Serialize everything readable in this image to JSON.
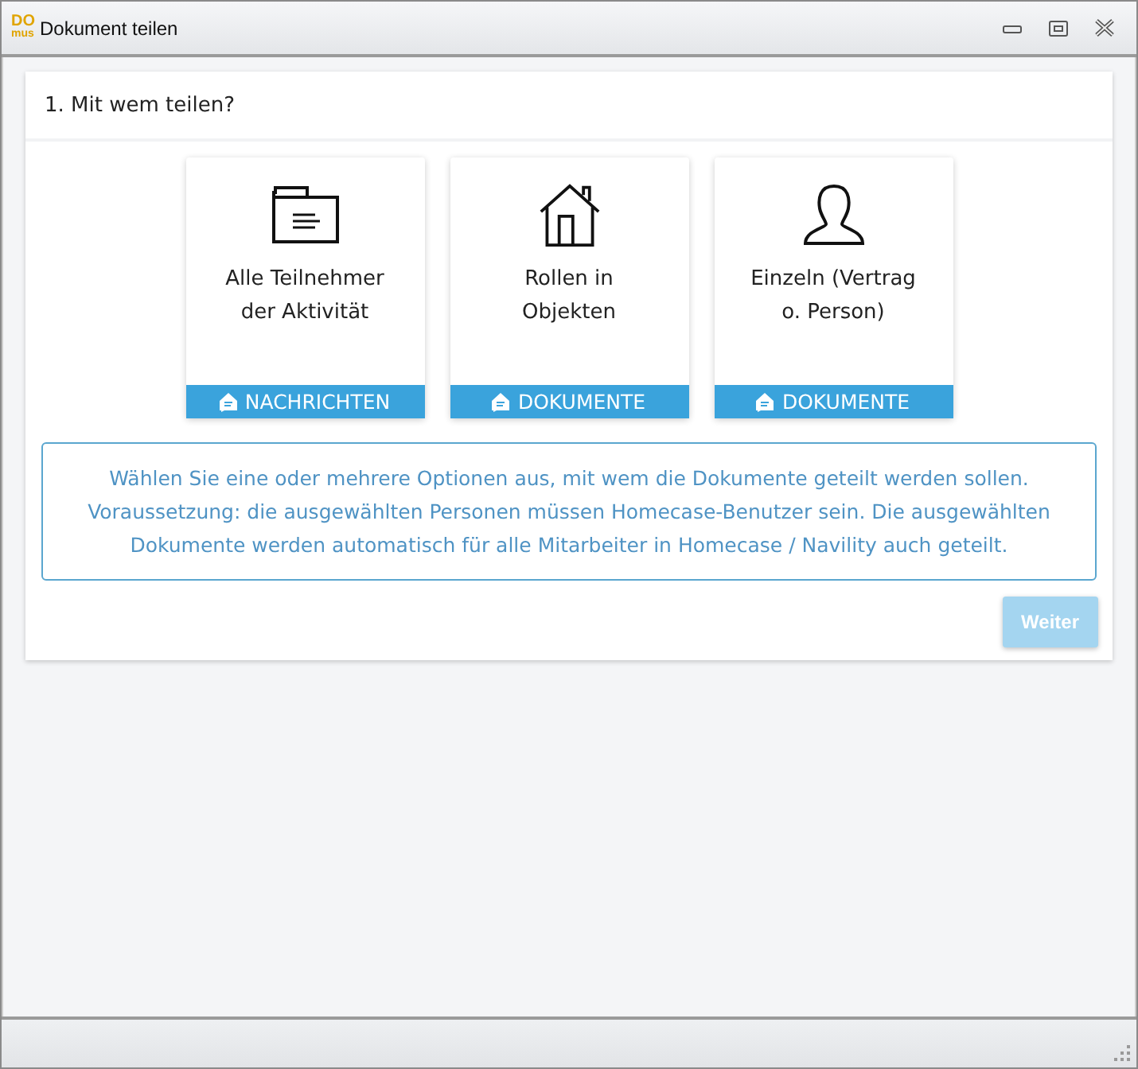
{
  "window": {
    "logo": [
      "DO",
      "mus"
    ],
    "title": "Dokument teilen"
  },
  "step": {
    "title": "1. Mit wem teilen?"
  },
  "options": [
    {
      "kind": "folder",
      "label": "Alle Teilnehmer der Aktivität",
      "badge": "NACHRICHTEN"
    },
    {
      "kind": "house",
      "label": "Rollen in Objekten",
      "badge": "DOKUMENTE"
    },
    {
      "kind": "person",
      "label": "Einzeln (Vertrag o. Person)",
      "badge": "DOKUMENTE"
    }
  ],
  "info": "Wählen Sie eine oder mehrere Optionen aus, mit wem die Dokumente geteilt werden sollen. Voraussetzung: die ausgewählten Personen müssen Homecase-Benutzer sein. Die ausgewählten Dokumente werden automatisch für alle Mitarbeiter in Homecase / Navility auch geteilt.",
  "next_button": {
    "label": "Weiter",
    "disabled": true
  }
}
